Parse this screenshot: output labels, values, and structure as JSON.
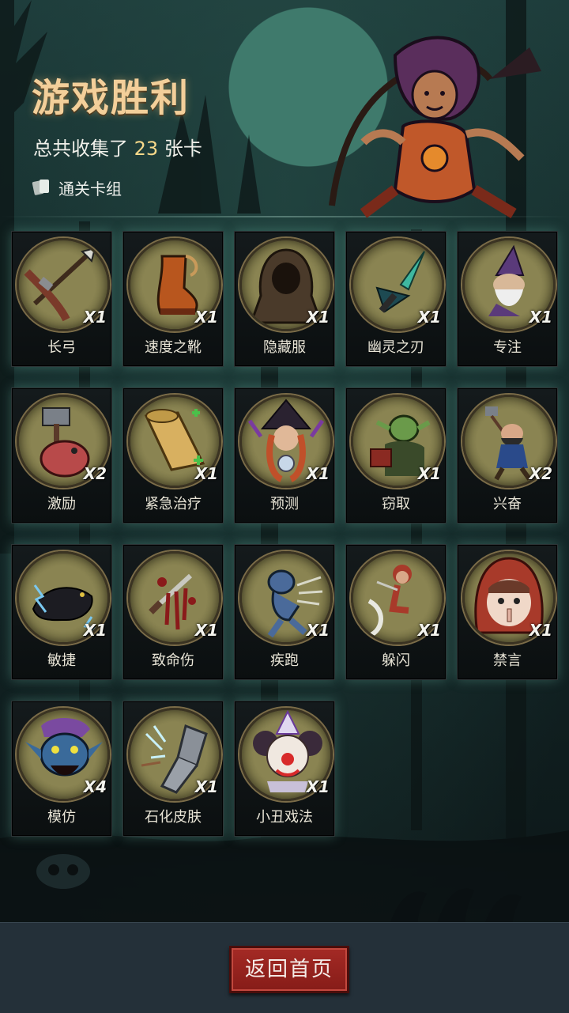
{
  "header": {
    "title": "游戏胜利",
    "summary_prefix": "总共收集了",
    "card_count": "23",
    "summary_suffix": "张卡",
    "deck_link_label": "通关卡组",
    "deck_icon": "cards-icon",
    "hero_icon": "hooded-archer-hero-icon"
  },
  "cards": [
    {
      "name": "长弓",
      "qty": "X1",
      "icon": "longbow-icon"
    },
    {
      "name": "速度之靴",
      "qty": "X1",
      "icon": "speed-boots-icon"
    },
    {
      "name": "隐藏服",
      "qty": "X1",
      "icon": "hooded-cloak-icon"
    },
    {
      "name": "幽灵之刃",
      "qty": "X1",
      "icon": "ghost-blade-icon"
    },
    {
      "name": "专注",
      "qty": "X1",
      "icon": "focus-wizard-icon"
    },
    {
      "name": "激励",
      "qty": "X2",
      "icon": "hammer-brute-icon"
    },
    {
      "name": "紧急治疗",
      "qty": "X1",
      "icon": "healing-scroll-icon"
    },
    {
      "name": "预测",
      "qty": "X1",
      "icon": "witch-crystal-ball-icon"
    },
    {
      "name": "窃取",
      "qty": "X1",
      "icon": "goblin-thief-icon"
    },
    {
      "name": "兴奋",
      "qty": "X2",
      "icon": "excited-dwarf-icon"
    },
    {
      "name": "敏捷",
      "qty": "X1",
      "icon": "panther-icon"
    },
    {
      "name": "致命伤",
      "qty": "X1",
      "icon": "bleeding-dagger-icon"
    },
    {
      "name": "疾跑",
      "qty": "X1",
      "icon": "sprinting-wolf-icon"
    },
    {
      "name": "躲闪",
      "qty": "X1",
      "icon": "dodging-hood-icon"
    },
    {
      "name": "禁言",
      "qty": "X1",
      "icon": "silence-hood-icon"
    },
    {
      "name": "模仿",
      "qty": "X4",
      "icon": "mimic-troll-icon"
    },
    {
      "name": "石化皮肤",
      "qty": "X1",
      "icon": "stone-skin-arm-icon"
    },
    {
      "name": "小丑戏法",
      "qty": "X1",
      "icon": "clown-icon"
    }
  ],
  "footer": {
    "home_button_label": "返回首页"
  },
  "colors": {
    "title": "#f3cf9a",
    "count": "#f7d98a",
    "medal": "#8a8452",
    "button": "#a42a25"
  }
}
